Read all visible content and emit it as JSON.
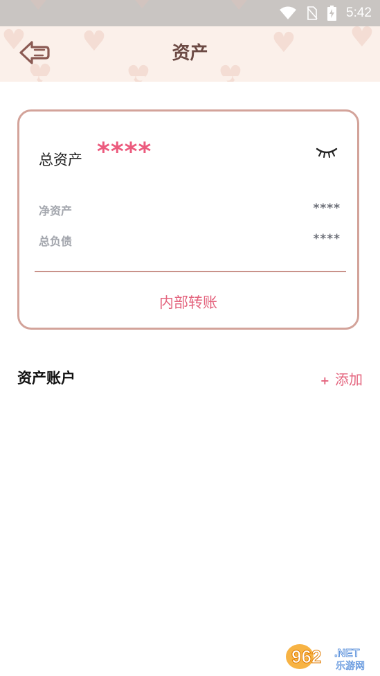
{
  "status_bar": {
    "time": "5:42"
  },
  "header": {
    "title": "资产"
  },
  "card": {
    "total_label": "总资产",
    "total_value": "****",
    "net_label": "净资产",
    "net_value": "****",
    "liability_label": "总负债",
    "liability_value": "****",
    "transfer_label": "内部转账"
  },
  "section": {
    "title": "资产账户",
    "add_plus": "+",
    "add_label": "添加"
  },
  "watermark": {
    "number": "962",
    "suffix": ".NET",
    "site": "乐游网"
  },
  "colors": {
    "accent": "#ec5b7e",
    "card_border": "#d3a39a",
    "header_bg": "#fbf0ea",
    "title": "#6c4a44"
  }
}
